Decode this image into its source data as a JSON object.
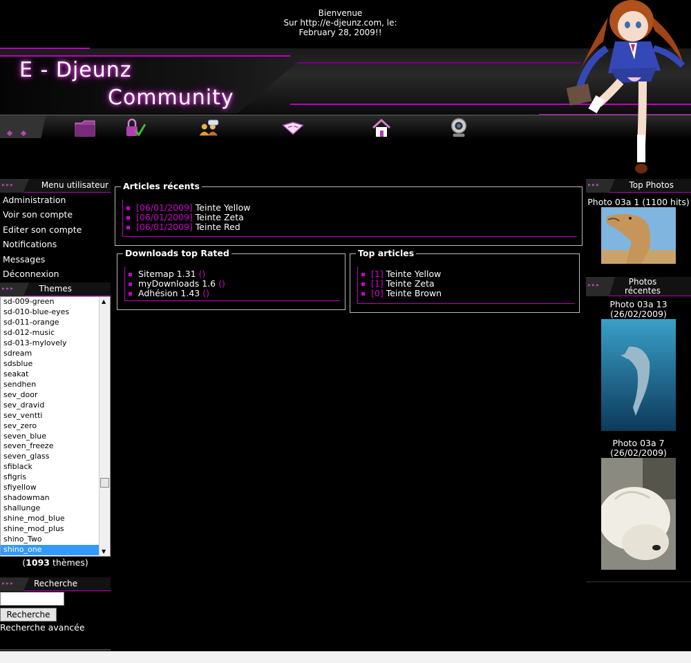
{
  "header": {
    "welcome_line1": "Bienvenue",
    "welcome_line2": "Sur http://e-djeunz.com, le:",
    "welcome_line3": "February 28, 2009!!",
    "logo_line1": "E - Djeunz",
    "logo_line2": "Community",
    "nav_icons": [
      "folder-icon",
      "lock-check-icon",
      "users-chat-icon",
      "book-icon",
      "home-icon",
      "webcam-icon"
    ]
  },
  "user_menu": {
    "title": "Menu utilisateur",
    "items": [
      "Administration",
      "Voir son compte",
      "Editer son compte",
      "Notifications",
      "Messages",
      "Déconnexion"
    ]
  },
  "themes": {
    "title": "Themes",
    "items": [
      "sd-009-green",
      "sd-010-blue-eyes",
      "sd-011-orange",
      "sd-012-music",
      "sd-013-mylovely",
      "sdream",
      "sdsblue",
      "seakat",
      "sendhen",
      "sev_door",
      "sev_dravid",
      "sev_ventti",
      "sev_zero",
      "seven_blue",
      "seven_freeze",
      "seven_glass",
      "sfiblack",
      "sfigris",
      "sfiyellow",
      "shadowman",
      "shallunge",
      "shine_mod_blue",
      "shine_mod_plus",
      "shino_Two",
      "shino_one"
    ],
    "selected": "shino_one",
    "count_open": "(",
    "count": "1093",
    "count_suffix": " thèmes)"
  },
  "search": {
    "title": "Recherche",
    "button_label": "Recherche",
    "advanced_label": "Recherche avancée",
    "value": ""
  },
  "recent_articles": {
    "title": "Articles récents",
    "items": [
      {
        "date": "[06/01/2009]",
        "title": "Teinte Yellow"
      },
      {
        "date": "[06/01/2009]",
        "title": "Teinte Zeta"
      },
      {
        "date": "[06/01/2009]",
        "title": "Teinte Red"
      }
    ]
  },
  "downloads": {
    "title": "Downloads top Rated",
    "items": [
      {
        "name": "Sitemap 1.31",
        "count": "()"
      },
      {
        "name": "myDownloads 1.6",
        "count": "()"
      },
      {
        "name": "Adhésion 1.43",
        "count": "()"
      }
    ]
  },
  "top_articles": {
    "title": "Top articles",
    "items": [
      {
        "count": "[1]",
        "title": "Teinte Yellow"
      },
      {
        "count": "[1]",
        "title": "Teinte Zeta"
      },
      {
        "count": "[0]",
        "title": "Teinte Brown"
      }
    ]
  },
  "top_photos": {
    "title": "Top Photos",
    "items": [
      {
        "caption": "Photo 03a 1 (1100 hits)",
        "subject": "camel"
      }
    ]
  },
  "recent_photos": {
    "title": "Photos récentes",
    "items": [
      {
        "caption": "Photo 03a 13 (26/02/2009)",
        "subject": "dolphin"
      },
      {
        "caption": "Photo 03a 7 (26/02/2009)",
        "subject": "polar-bear"
      }
    ]
  },
  "colors": {
    "accent": "#cc00cc",
    "link_date": "#d000d0",
    "background": "#000000",
    "selected_item": "#3399ff"
  }
}
